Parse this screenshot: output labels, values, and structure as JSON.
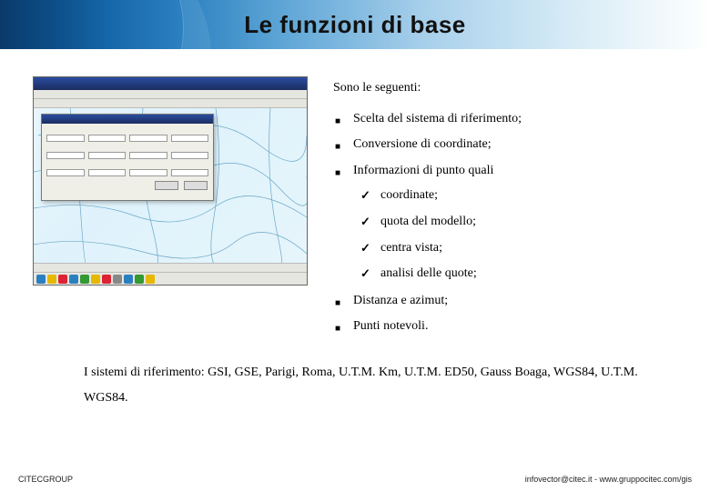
{
  "title": "Le funzioni di base",
  "intro": "Sono le seguenti:",
  "items": [
    "Scelta del sistema di riferimento;",
    "Conversione di coordinate;",
    "Informazioni di punto quali",
    "Distanza e azimut;",
    "Punti notevoli."
  ],
  "sub_items": [
    "coordinate;",
    "quota del modello;",
    "centra vista;",
    "analisi delle quote;"
  ],
  "note": "I sistemi di riferimento: GSI, GSE, Parigi, Roma, U.T.M. Km, U.T.M. ED50, Gauss Boaga, WGS84, U.T.M. WGS84.",
  "footer_left": "CITECGROUP",
  "footer_right": "infovector@citec.it - www.gruppocitec.com/gis"
}
